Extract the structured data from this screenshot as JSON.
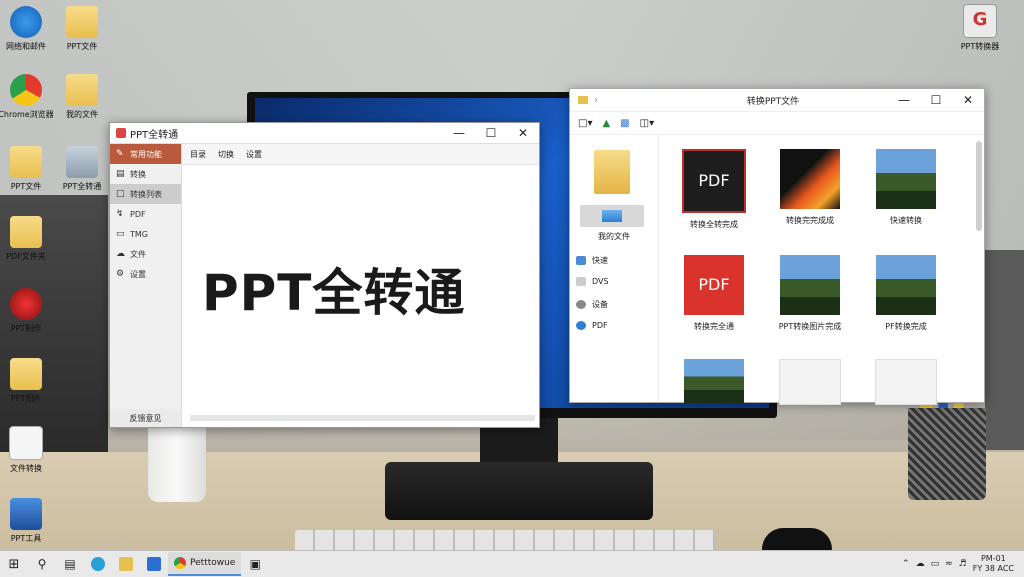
{
  "desktop_icons": [
    {
      "label": "网络和邮件",
      "icon": "network-icon"
    },
    {
      "label": "PPT文件",
      "icon": "folder-icon"
    },
    {
      "label": "Chrome浏览器",
      "icon": "chrome-icon"
    },
    {
      "label": "我的文件",
      "icon": "folder-icon"
    },
    {
      "label": "PPT文件",
      "icon": "folder-icon"
    },
    {
      "label": "PPT全转通",
      "icon": "drive-icon"
    },
    {
      "label": "PDF文件夹",
      "icon": "folder-icon"
    },
    {
      "label": "PPT制作",
      "icon": "app-icon"
    },
    {
      "label": "PPT图片",
      "icon": "folder-icon"
    },
    {
      "label": "文件转换",
      "icon": "document-icon"
    },
    {
      "label": "PPT工具",
      "icon": "box-icon"
    }
  ],
  "top_right_icon": {
    "label": "PPT转换器",
    "glyph": "G"
  },
  "ppt_window": {
    "title": "PPT全转通",
    "main_text": "PPT全转通",
    "sidebar": [
      {
        "label": "常用功能",
        "icon": "pen-icon"
      },
      {
        "label": "转换",
        "icon": "doc-icon"
      },
      {
        "label": "转换列表",
        "icon": "list-icon"
      },
      {
        "label": "PDF",
        "icon": "pdf-icon"
      },
      {
        "label": "TMG",
        "icon": "image-icon"
      },
      {
        "label": "文件",
        "icon": "cloud-icon"
      },
      {
        "label": "设置",
        "icon": "gear-icon"
      }
    ],
    "toolbar": [
      "目录",
      "切换",
      "设置"
    ],
    "footer": "反馈意见"
  },
  "explorer_window": {
    "title": "转换PPT文件",
    "sidebar_caption": "我的文件",
    "nav_items": [
      {
        "label": "快速",
        "icon": "quick-icon"
      },
      {
        "label": "DVS",
        "icon": "drive-icon"
      },
      {
        "label": "设备",
        "icon": "disk-icon"
      },
      {
        "label": "PDF",
        "icon": "globe-icon"
      }
    ],
    "files": [
      {
        "label": "转换全转完成",
        "thumb": "pdfdark",
        "text": "PDF"
      },
      {
        "label": "转换完完成成",
        "thumb": "chart",
        "text": ""
      },
      {
        "label": "快速转换",
        "thumb": "land",
        "text": ""
      },
      {
        "label": "转换完全通",
        "thumb": "pdfred",
        "text": "PDF"
      },
      {
        "label": "PPT转换图片完成",
        "thumb": "land",
        "text": ""
      },
      {
        "label": "PF转换完成",
        "thumb": "land",
        "text": ""
      },
      {
        "label": "",
        "thumb": "land",
        "text": ""
      },
      {
        "label": "",
        "thumb": "blank",
        "text": ""
      },
      {
        "label": "",
        "thumb": "blank",
        "text": ""
      }
    ]
  },
  "taskbar": {
    "app_label": "Petttowue",
    "time": "PM-01",
    "date": "FY 38 ACC"
  }
}
